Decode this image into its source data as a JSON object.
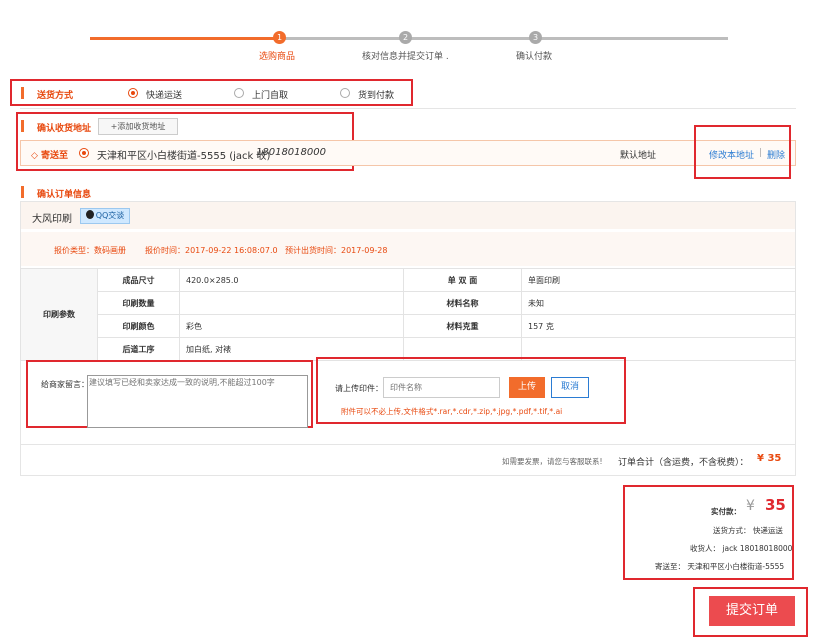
{
  "steps": [
    {
      "num": "1",
      "label": "选购商品"
    },
    {
      "num": "2",
      "label": "核对信息并提交订单 ."
    },
    {
      "num": "3",
      "label": "确认付款"
    }
  ],
  "delivery": {
    "title": "送货方式",
    "options": [
      "快递运送",
      "上门自取",
      "货到付款"
    ],
    "selected": "快递运送"
  },
  "address": {
    "title": "确认收货地址",
    "add_button": "+添加收货地址",
    "send_to": "◇ 寄送至",
    "text": "天津和平区小白楼街道-5555 (jack 收)",
    "phone": "18018018000",
    "default_label": "默认地址",
    "edit_link": "修改本地址",
    "separator": "|",
    "delete_link": "删除"
  },
  "order": {
    "title": "确认订单信息",
    "shop_name": "大风印刷",
    "qq_button": "QQ交谈",
    "quote_type": "报价类型：数码画册",
    "quote_time": "报价时间：2017-09-22 16:08:07.0",
    "ship_time": "预计出货时间：2017-09-28",
    "param_label": "印刷参数",
    "params": [
      {
        "k1": "成品尺寸",
        "v1": "420.0×285.0",
        "k2": "单 双 面",
        "v2": "单面印刷"
      },
      {
        "k1": "印刷数量",
        "v1": "",
        "k2": "材料名称",
        "v2": "未知"
      },
      {
        "k1": "印刷颜色",
        "v1": "彩色",
        "k2": "材料克重",
        "v2": "157 克"
      },
      {
        "k1": "后道工序",
        "v1": "加白纸, 对裱",
        "k2": "",
        "v2": ""
      }
    ],
    "message_label": "给商家留言：",
    "message_placeholder": "建议填写已经和卖家达成一致的说明,不能超过100字",
    "upload_label": "请上传印件：",
    "upload_placeholder": "印件名称",
    "upload_button": "上传",
    "cancel_button": "取消",
    "upload_hint": "附件可以不必上传,文件格式*.rar,*.cdr,*.zip,*.jpg,*.pdf,*.tif,*.ai",
    "invoice_note": "如需要发票，请您与客服联系!",
    "total_label": "订单合计（含运费，不含税费）：",
    "total_value": "¥ 35"
  },
  "summary": {
    "pay_label": "实付款：",
    "currency": "¥",
    "amount": "35",
    "delivery": "送货方式： 快递运送",
    "receiver": "收货人： jack 18018018000",
    "send_to": "寄送至： 天津和平区小白楼街道-5555"
  },
  "submit_button": "提交订单",
  "colors": {
    "accent": "#f26c2b",
    "highlight": "#e0282e",
    "link": "#2b7cd3"
  }
}
